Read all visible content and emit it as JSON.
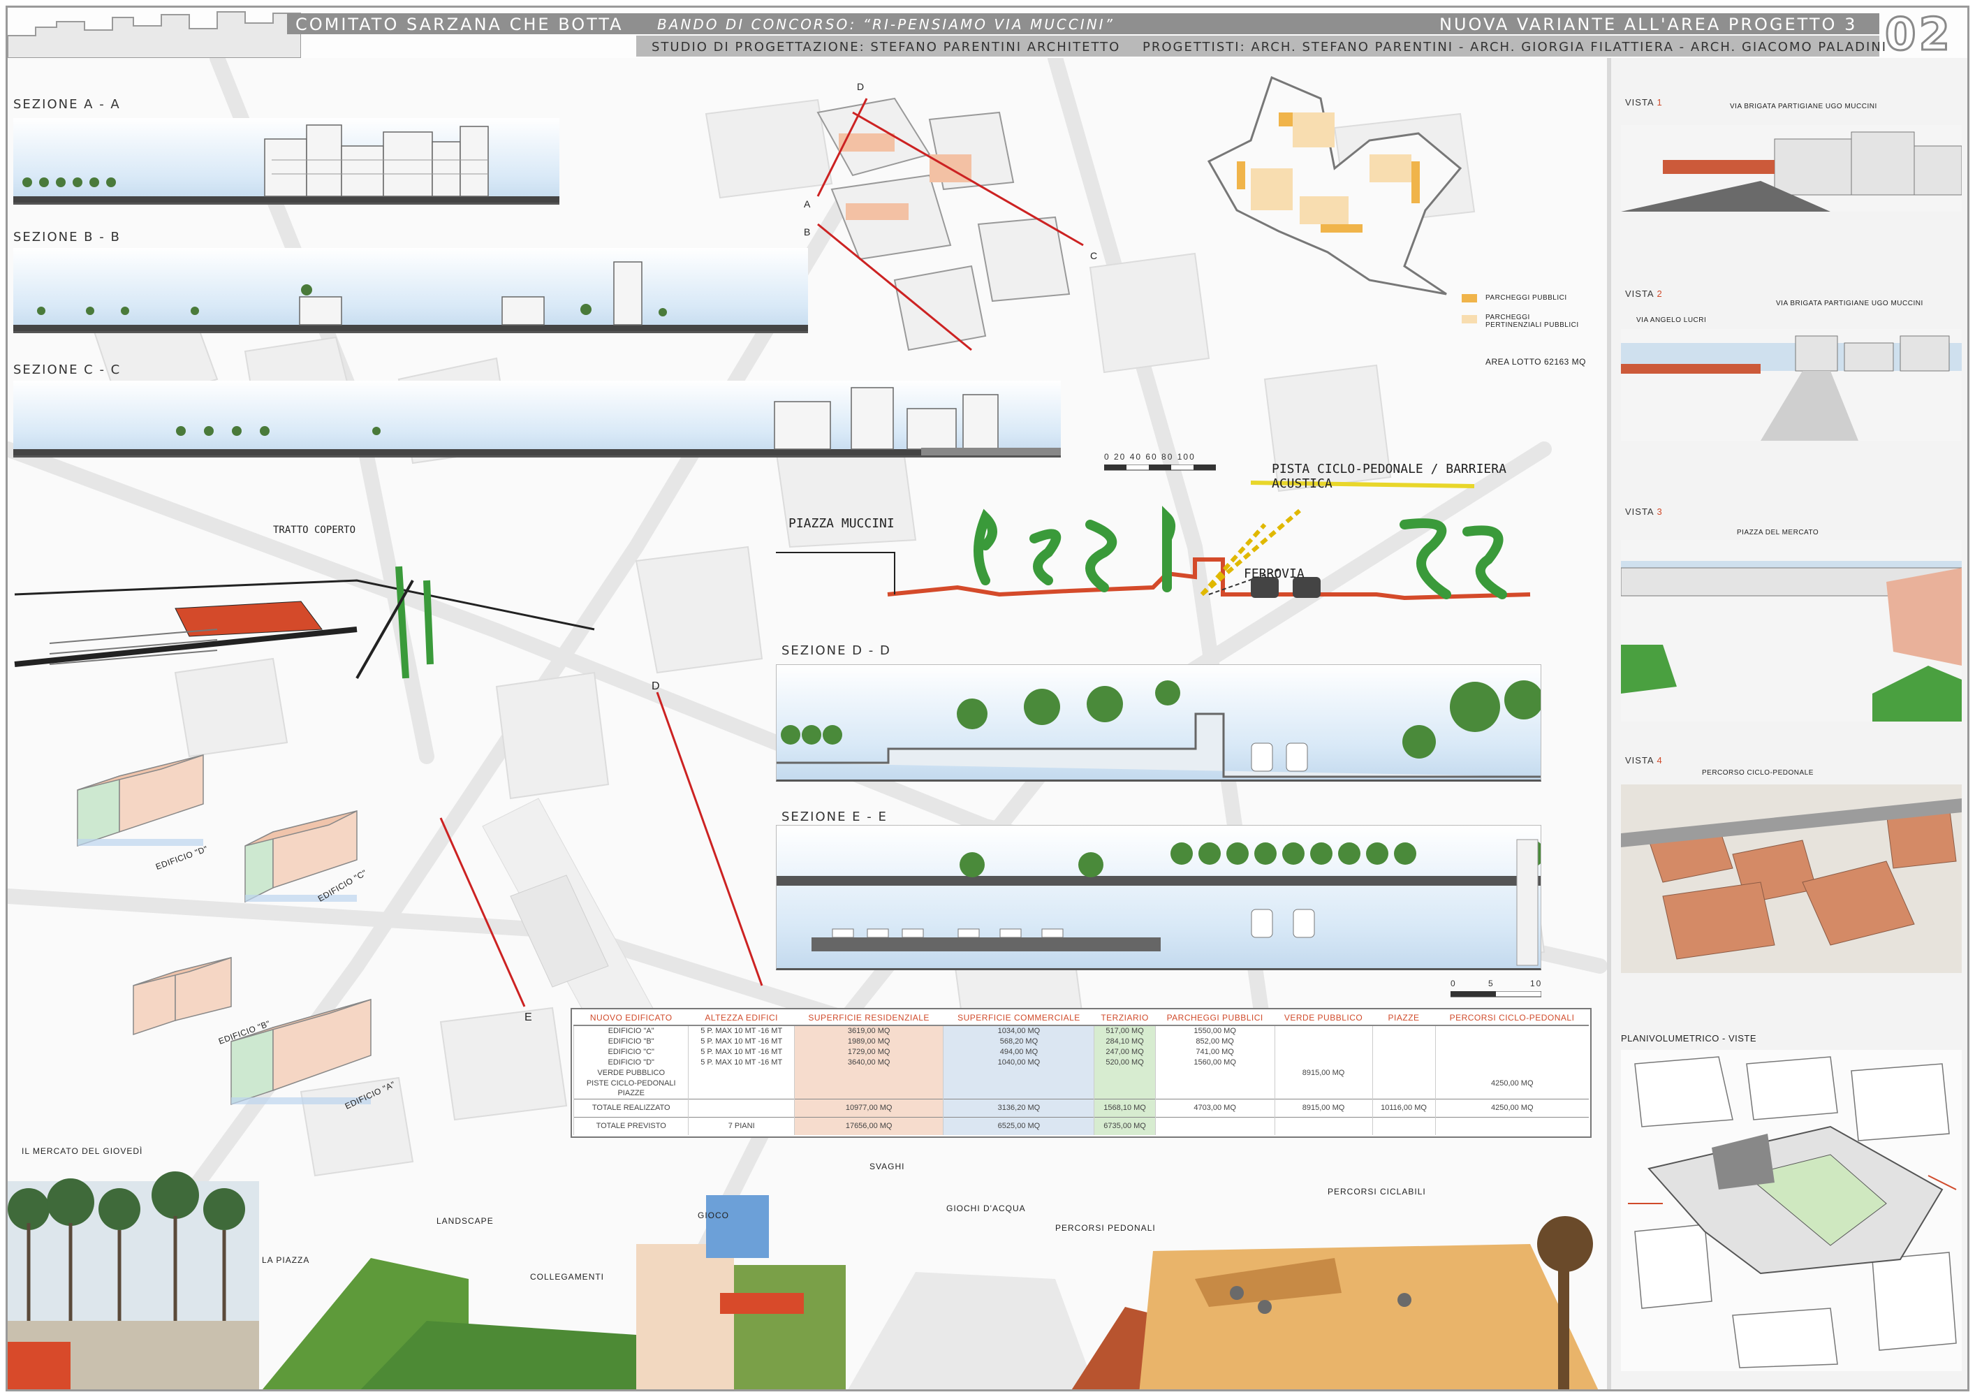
{
  "header": {
    "title": "COMITATO SARZANA CHE BOTTA",
    "bando": "BANDO DI CONCORSO: “RI-PENSIAMO VIA MUCCINI”",
    "variante": "NUOVA VARIANTE ALL'AREA PROGETTO 3",
    "studio": "STUDIO DI PROGETTAZIONE: STEFANO PARENTINI ARCHITETTO",
    "progettisti": "PROGETTISTI: ARCH. STEFANO PARENTINI - ARCH. GIORGIA FILATTIERA - ARCH. GIACOMO PALADINI",
    "sheet_number": "02"
  },
  "sections": {
    "a": "SEZIONE A - A",
    "b": "SEZIONE B - B",
    "c": "SEZIONE C - C",
    "d": "SEZIONE D - D",
    "e": "SEZIONE E - E"
  },
  "plan_labels": {
    "A": "A",
    "B": "B",
    "C": "C",
    "D": "D",
    "E": "E"
  },
  "parking_legend": {
    "pubblici": "PARCHEGGI PUBBLICI",
    "pertinenziali": "PARCHEGGI PERTINENZIALI PUBBLICI",
    "area_lotto": "AREA LOTTO 62163 MQ",
    "color_pubblici": "#f0b44a",
    "color_pertinenziali": "#f8ddb0"
  },
  "scale_bar": {
    "top": "0  20  40  60  80  100",
    "bottom_0": "0",
    "bottom_5": "5",
    "bottom_10": "10"
  },
  "sketch": {
    "piazza_muccini": "PIAZZA MUCCINI",
    "pista": "PISTA CICLO-PEDONALE / BARRIERA ACUSTICA",
    "ferrovia": "FERROVIA",
    "tratto_coperto": "TRATTO COPERTO"
  },
  "buildings": {
    "d": "EDIFICIO \"D\"",
    "c": "EDIFICIO \"C\"",
    "b": "EDIFICIO \"B\"",
    "a": "EDIFICIO \"A\""
  },
  "table": {
    "headers": [
      "NUOVO EDIFICATO",
      "ALTEZZA EDIFICI",
      "SUPERFICIE RESIDENZIALE",
      "SUPERFICIE COMMERCIALE",
      "TERZIARIO",
      "PARCHEGGI PUBBLICI",
      "VERDE PUBBLICO",
      "PIAZZE",
      "PERCORSI CICLO-PEDONALI"
    ],
    "rows": [
      [
        "EDIFICIO \"A\"",
        "5 P. MAX 10 MT -16 MT",
        "3619,00 MQ",
        "1034,00 MQ",
        "517,00 MQ",
        "1550,00 MQ",
        "",
        "",
        ""
      ],
      [
        "EDIFICIO \"B\"",
        "5 P. MAX 10 MT -16 MT",
        "1989,00 MQ",
        "568,20 MQ",
        "284,10 MQ",
        "852,00 MQ",
        "",
        "",
        ""
      ],
      [
        "EDIFICIO \"C\"",
        "5 P. MAX 10 MT -16 MT",
        "1729,00 MQ",
        "494,00 MQ",
        "247,00 MQ",
        "741,00 MQ",
        "",
        "",
        ""
      ],
      [
        "EDIFICIO \"D\"",
        "5 P. MAX 10 MT -16 MT",
        "3640,00 MQ",
        "1040,00 MQ",
        "520,00 MQ",
        "1560,00 MQ",
        "",
        "",
        ""
      ],
      [
        "VERDE PUBBLICO",
        "",
        "",
        "",
        "",
        "",
        "8915,00 MQ",
        "",
        ""
      ],
      [
        "PISTE CICLO-PEDONALI",
        "",
        "",
        "",
        "",
        "",
        "",
        "",
        "4250,00 MQ"
      ],
      [
        "PIAZZE",
        "",
        "",
        "",
        "",
        "",
        "",
        "",
        ""
      ]
    ],
    "total_realizzato": [
      "TOTALE REALIZZATO",
      "",
      "10977,00 MQ",
      "3136,20 MQ",
      "1568,10 MQ",
      "4703,00 MQ",
      "8915,00 MQ",
      "10116,00 MQ",
      "4250,00 MQ"
    ],
    "total_previsto": [
      "TOTALE PREVISTO",
      "7 PIANI",
      "17656,00 MQ",
      "6525,00 MQ",
      "6735,00 MQ",
      "",
      "",
      "",
      ""
    ]
  },
  "right": {
    "vista1": "VISTA",
    "vista1_n": "1",
    "vista1_cap": "VIA BRIGATA PARTIGIANE UGO MUCCINI",
    "vista2": "VISTA",
    "vista2_n": "2",
    "vista2_cap1": "VIA ANGELO LUCRI",
    "vista2_cap2": "VIA BRIGATA PARTIGIANE UGO MUCCINI",
    "vista3": "VISTA",
    "vista3_n": "3",
    "vista3_cap": "PIAZZA DEL MERCATO",
    "vista4": "VISTA",
    "vista4_n": "4",
    "vista4_cap": "PERCORSO CICLO-PEDONALE",
    "planivolumetrico": "PLANIVOLUMETRICO - VISTE"
  },
  "collage": {
    "mercato": "IL MERCATO DEL GIOVEDÌ",
    "piazza": "LA PIAZZA",
    "landscape": "LANDSCAPE",
    "collegamenti": "COLLEGAMENTI",
    "gioco": "GIOCO",
    "svaghi": "SVAGHI",
    "giochi_acqua": "GIOCHI D'ACQUA",
    "percorsi_pedonali": "PERCORSI PEDONALI",
    "percorsi_ciclabili": "PERCORSI CICLABILI"
  }
}
